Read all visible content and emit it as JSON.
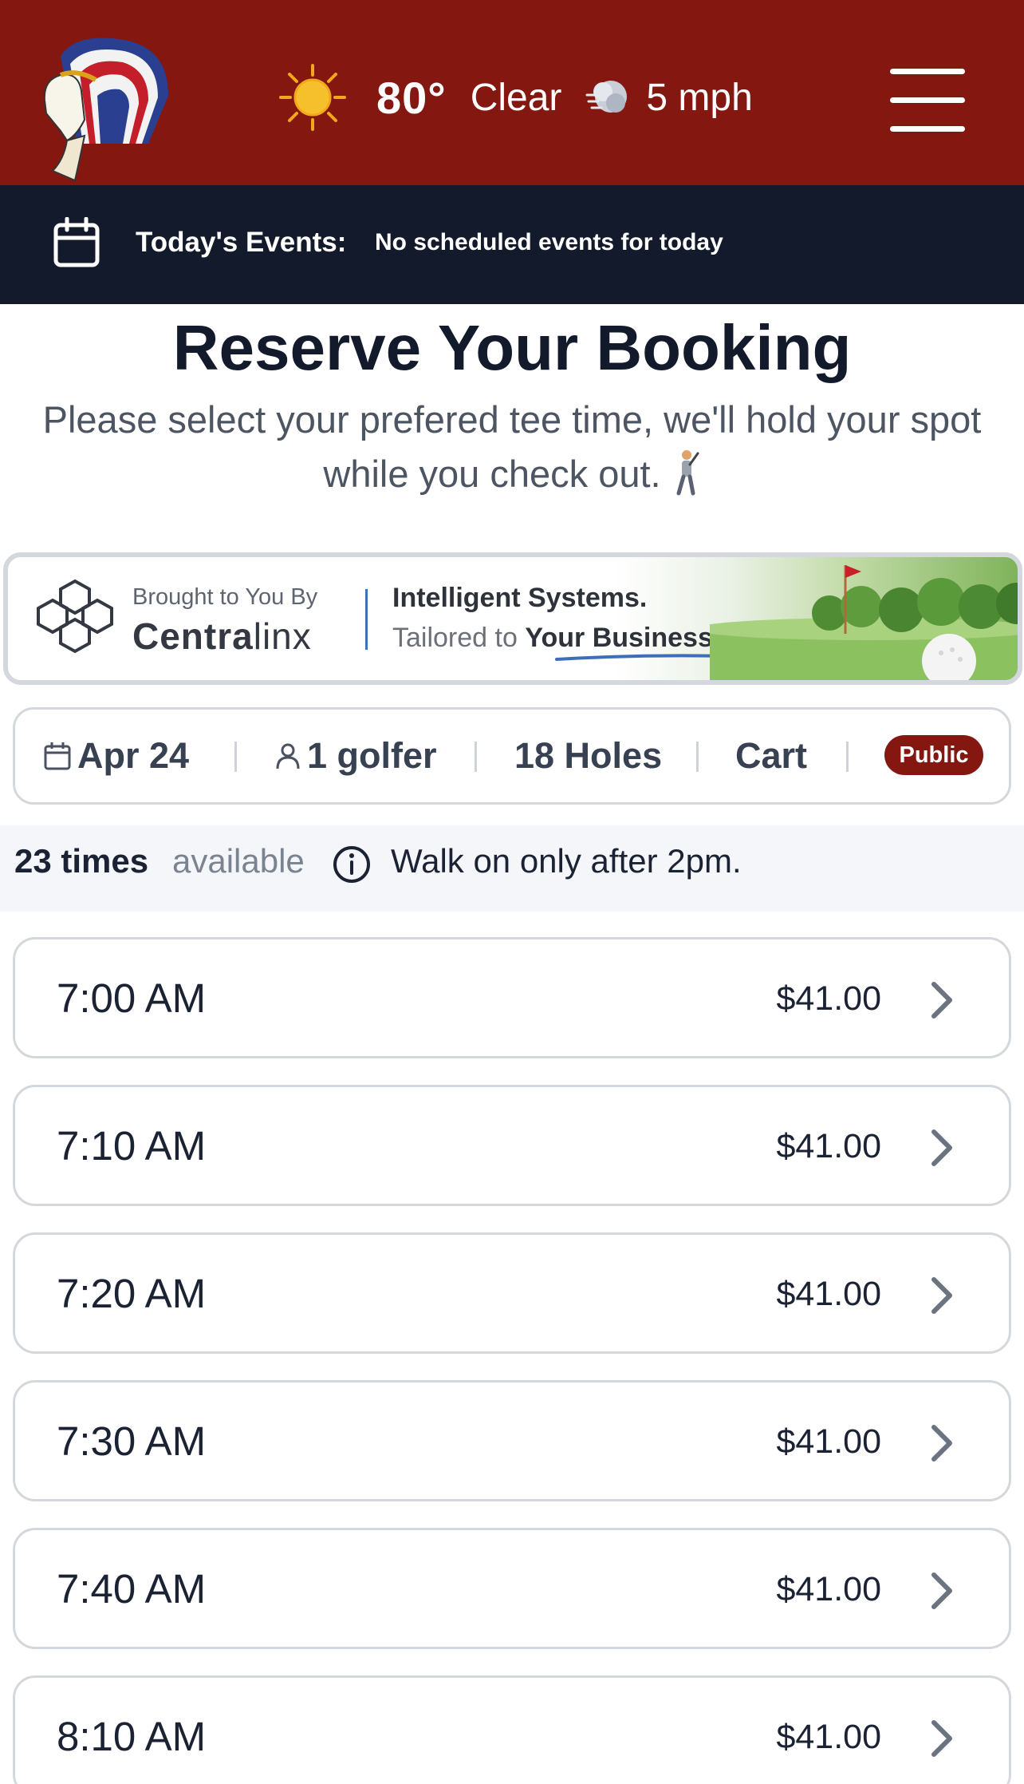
{
  "header": {
    "weather": {
      "icon": "sun-icon",
      "temperature": "80°",
      "condition": "Clear",
      "wind_icon": "wind-icon",
      "wind": "5 mph"
    },
    "menu_icon": "hamburger-menu-icon",
    "colors": {
      "brand": "#841811",
      "events_bar": "#131a2b"
    }
  },
  "events": {
    "icon": "calendar-icon",
    "label": "Today's Events:",
    "text": "No scheduled events for today"
  },
  "page": {
    "title": "Reserve Your Booking",
    "subtitle": "Please select your prefered tee time, we'll hold your spot while you check out."
  },
  "banner": {
    "brought_by": "Brought to You By",
    "brand_strong": "Centra",
    "brand_light": "linx",
    "tagline_1": "Intelligent Systems.",
    "tagline_2a": "Tailored to",
    "tagline_2b": "Your Business."
  },
  "filters": {
    "date": "Apr 24",
    "golfers": "1 golfer",
    "holes": "18 Holes",
    "cart": "Cart",
    "rate": "Public"
  },
  "availability": {
    "count": "23 times",
    "label": "available",
    "note": "Walk on only after 2pm."
  },
  "tee_times": [
    {
      "time": "7:00 AM",
      "price": "$41.00"
    },
    {
      "time": "7:10 AM",
      "price": "$41.00"
    },
    {
      "time": "7:20 AM",
      "price": "$41.00"
    },
    {
      "time": "7:30 AM",
      "price": "$41.00"
    },
    {
      "time": "7:40 AM",
      "price": "$41.00"
    },
    {
      "time": "8:10 AM",
      "price": "$41.00"
    }
  ]
}
